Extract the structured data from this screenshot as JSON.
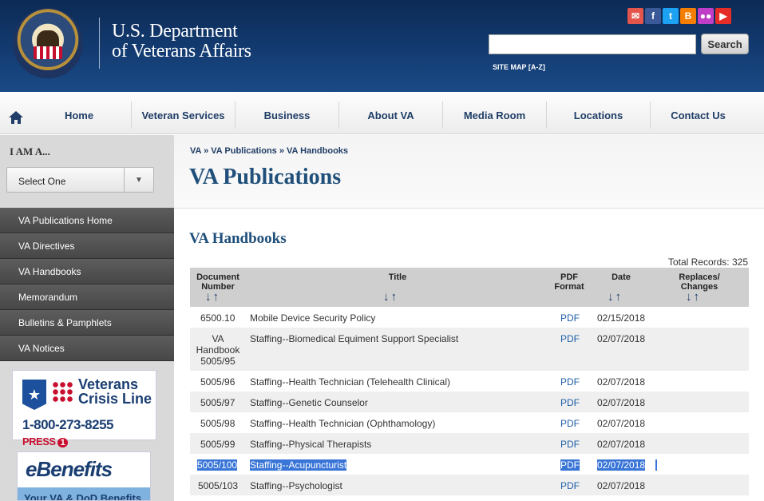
{
  "header": {
    "agency_line1": "U.S. Department",
    "agency_line2": "of Veterans Affairs",
    "search_button": "Search",
    "search_placeholder": "",
    "site_map": "SITE MAP [A-Z]",
    "social_icons": [
      "email-icon",
      "facebook-icon",
      "twitter-icon",
      "blogger-icon",
      "flickr-icon",
      "youtube-icon"
    ],
    "colors": {
      "header_bg": "#143d74",
      "accent": "#1f3d66"
    }
  },
  "nav": {
    "items": [
      "Home",
      "Veteran Services",
      "Business",
      "About VA",
      "Media Room",
      "Locations",
      "Contact Us"
    ]
  },
  "sidebar": {
    "i_am": "I AM A...",
    "select_value": "Select One",
    "menu": [
      "VA Publications Home",
      "VA Directives",
      "VA Handbooks",
      "Memorandum",
      "Bulletins & Pamphlets",
      "VA Notices"
    ],
    "crisis": {
      "line1": "Veterans",
      "line2": "Crisis Line",
      "phone": "1-800-273-8255",
      "press": "PRESS",
      "press_num": "1"
    },
    "ebenefits": {
      "logo": "eBenefits",
      "tagline": "Your VA & DoD Benefits"
    }
  },
  "main": {
    "breadcrumb": "VA » VA Publications » VA Handbooks",
    "title": "VA Publications",
    "section": "VA Handbooks",
    "total_records": "Total Records: 325",
    "columns": {
      "doc_number_1": "Document",
      "doc_number_2": "Number",
      "title": "Title",
      "pdf_1": "PDF",
      "pdf_2": "Format",
      "date": "Date",
      "replaces_1": "Replaces/",
      "replaces_2": "Changes"
    },
    "rows": [
      {
        "num": "6500.10",
        "title": "Mobile Device Security Policy",
        "pdf": "PDF",
        "date": "02/15/2018"
      },
      {
        "num": "VA Handbook 5005/95",
        "title": "Staffing--Biomedical Equiment Support Specialist",
        "pdf": "PDF",
        "date": "02/07/2018"
      },
      {
        "num": "5005/96",
        "title": "Staffing--Health Technician (Telehealth Clinical)",
        "pdf": "PDF",
        "date": "02/07/2018"
      },
      {
        "num": "5005/97",
        "title": "Staffing--Genetic Counselor",
        "pdf": "PDF",
        "date": "02/07/2018"
      },
      {
        "num": "5005/98",
        "title": "Staffing--Health Technician (Ophthamology)",
        "pdf": "PDF",
        "date": "02/07/2018"
      },
      {
        "num": "5005/99",
        "title": "Staffing--Physical Therapists",
        "pdf": "PDF",
        "date": "02/07/2018"
      },
      {
        "num": "5005/100",
        "title": "Staffing--Acupuncturist",
        "pdf": "PDF",
        "date": "02/07/2018"
      },
      {
        "num": "5005/103",
        "title": "Staffing--Psychologist",
        "pdf": "PDF",
        "date": "02/07/2018"
      }
    ]
  }
}
